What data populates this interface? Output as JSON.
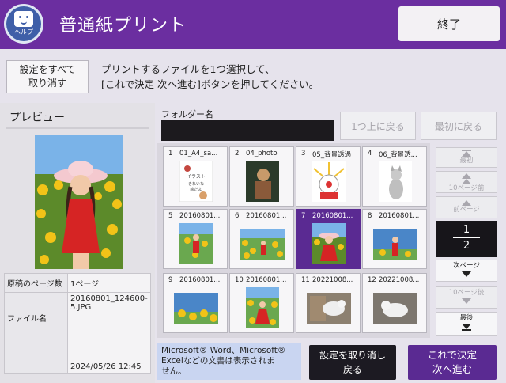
{
  "header": {
    "help_label": "ヘルプ",
    "title": "普通紙プリント",
    "end_button": "終了"
  },
  "toolbar": {
    "cancel_all_line1": "設定をすべて",
    "cancel_all_line2": "取り消す",
    "instruction_line1": "プリントするファイルを1つ選択して、",
    "instruction_line2": "[これで決定 次へ進む]ボタンを押してください。"
  },
  "preview": {
    "label": "プレビュー",
    "rows": [
      {
        "key": "原稿のページ数",
        "value": "1ページ"
      },
      {
        "key": "ファイル名",
        "value": "20160801_124600-5.JPG"
      },
      {
        "key": "",
        "value": "2024/05/26 12:45"
      }
    ]
  },
  "folder": {
    "label": "フォルダー名",
    "name": "",
    "up_button": "1つ上に戻る",
    "first_button": "最初に戻る"
  },
  "files": [
    {
      "num": "1",
      "name": "01_A4_sa...",
      "thumb_text": "イラスト きれいな 絵だよ",
      "selected": false
    },
    {
      "num": "2",
      "name": "04_photo",
      "selected": false
    },
    {
      "num": "3",
      "name": "05_背景透過",
      "selected": false
    },
    {
      "num": "4",
      "name": "06_背景透...",
      "selected": false
    },
    {
      "num": "5",
      "name": "20160801...",
      "selected": false
    },
    {
      "num": "6",
      "name": "20160801...",
      "selected": false
    },
    {
      "num": "7",
      "name": "20160801...",
      "selected": true
    },
    {
      "num": "8",
      "name": "20160801...",
      "selected": false
    },
    {
      "num": "9",
      "name": "20160801...",
      "selected": false
    },
    {
      "num": "10",
      "name": "20160801...",
      "selected": false
    },
    {
      "num": "11",
      "name": "20221008...",
      "selected": false
    },
    {
      "num": "12",
      "name": "20221008...",
      "selected": false
    }
  ],
  "pager": {
    "first": "最初",
    "back10": "10ページ前",
    "prev": "前ページ",
    "current": "1",
    "total": "2",
    "next": "次ページ",
    "fwd10": "10ページ後",
    "last": "最後"
  },
  "footer": {
    "note_line1": "Microsoft® Word、Microsoft®",
    "note_line2": "Excelなどの文書は表示されま",
    "note_line3": "せん。",
    "cancel_back_line1": "設定を取り消し",
    "cancel_back_line2": "戻る",
    "confirm_line1": "これで決定",
    "confirm_line2": "次へ進む"
  },
  "colors": {
    "brand_purple": "#6b2ea0",
    "selected_tile": "#5a2a92",
    "note_bg": "#c9d5f1"
  }
}
